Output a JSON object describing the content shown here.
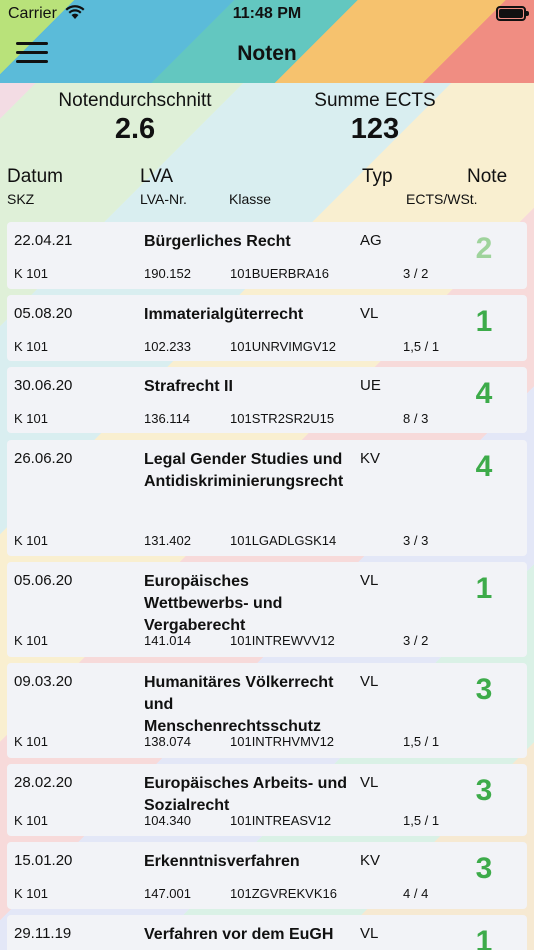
{
  "status": {
    "carrier": "Carrier",
    "time": "11:48 PM"
  },
  "nav": {
    "title": "Noten",
    "menu_icon": "hamburger-menu-icon"
  },
  "summary": {
    "average_label": "Notendurchschnitt",
    "average_value": "2.6",
    "ects_label": "Summe ECTS",
    "ects_value": "123"
  },
  "columns": {
    "datum": "Datum",
    "skz": "SKZ",
    "lva": "LVA",
    "lva_nr": "LVA-Nr.",
    "klasse": "Klasse",
    "typ": "Typ",
    "note": "Note",
    "ects_wst": "ECTS/WSt."
  },
  "colors": {
    "grade_green": "#3dab4a",
    "grade_light_green": "#9fd39c"
  },
  "grades": [
    {
      "date": "22.04.21",
      "title": "Bürgerliches Recht",
      "typ": "AG",
      "note": "2",
      "skz": "K 101",
      "lva_nr": "190.152",
      "klasse": "101BUERBRA16",
      "ects": "3 / 2"
    },
    {
      "date": "05.08.20",
      "title": "Immaterialgüterrecht",
      "typ": "VL",
      "note": "1",
      "skz": "K 101",
      "lva_nr": "102.233",
      "klasse": "101UNRVIMGV12",
      "ects": "1,5 / 1"
    },
    {
      "date": "30.06.20",
      "title": "Strafrecht II",
      "typ": "UE",
      "note": "4",
      "skz": "K 101",
      "lva_nr": "136.114",
      "klasse": "101STR2SR2U15",
      "ects": "8 / 3"
    },
    {
      "date": "26.06.20",
      "title": "Legal Gender Studies und Antidiskriminierungsrecht",
      "typ": "KV",
      "note": "4",
      "skz": "K 101",
      "lva_nr": "131.402",
      "klasse": "101LGADLGSK14",
      "ects": "3 / 3"
    },
    {
      "date": "05.06.20",
      "title": "Europäisches Wettbewerbs- und Vergaberecht",
      "typ": "VL",
      "note": "1",
      "skz": "K 101",
      "lva_nr": "141.014",
      "klasse": "101INTREWVV12",
      "ects": "3 / 2"
    },
    {
      "date": "09.03.20",
      "title": "Humanitäres Völkerrecht und Menschenrechtsschutz",
      "typ": "VL",
      "note": "3",
      "skz": "K 101",
      "lva_nr": "138.074",
      "klasse": "101INTRHVMV12",
      "ects": "1,5 / 1"
    },
    {
      "date": "28.02.20",
      "title": "Europäisches Arbeits- und Sozialrecht",
      "typ": "VL",
      "note": "3",
      "skz": "K 101",
      "lva_nr": "104.340",
      "klasse": "101INTREASV12",
      "ects": "1,5 / 1"
    },
    {
      "date": "15.01.20",
      "title": "Erkenntnisverfahren",
      "typ": "KV",
      "note": "3",
      "skz": "K 101",
      "lva_nr": "147.001",
      "klasse": "101ZGVREKVK16",
      "ects": "4 / 4"
    },
    {
      "date": "29.11.19",
      "title": "Verfahren vor dem EuGH",
      "typ": "VL",
      "note": "1",
      "skz": "",
      "lva_nr": "",
      "klasse": "",
      "ects": ""
    }
  ]
}
